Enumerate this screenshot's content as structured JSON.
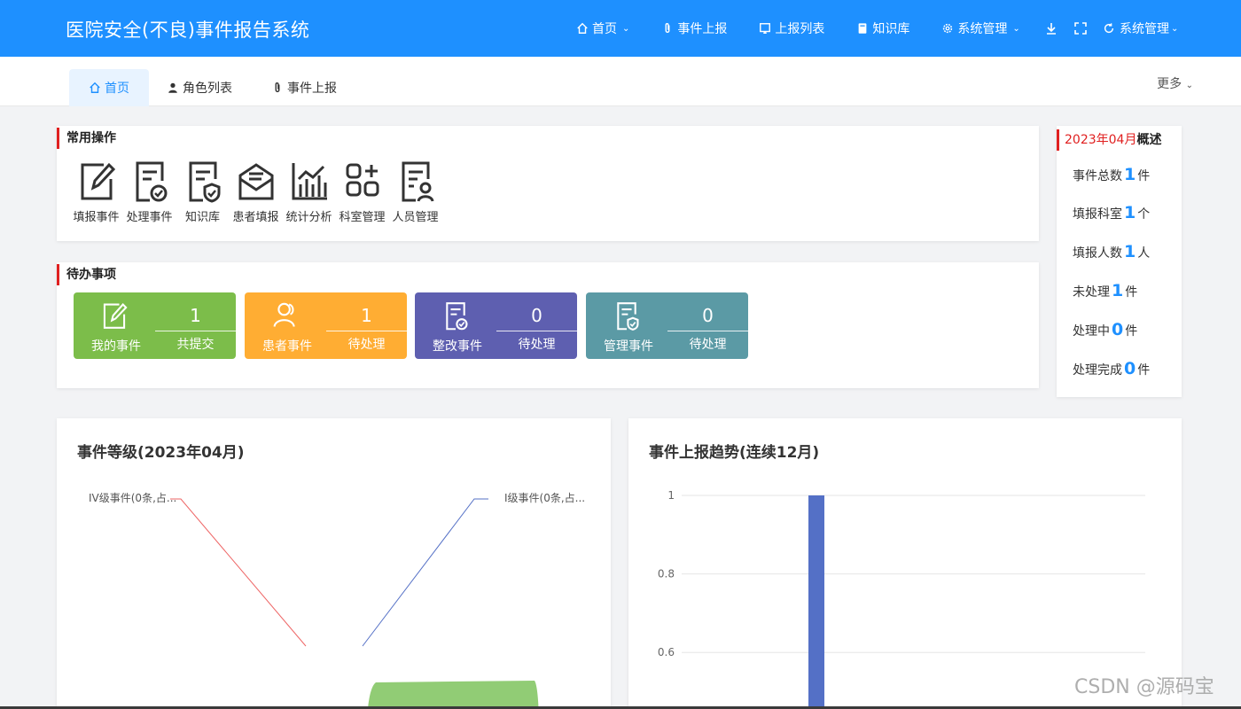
{
  "header": {
    "title": "医院安全(不良)事件报告系统",
    "nav": [
      {
        "label": "首页",
        "icon": "home-icon",
        "has_dropdown": true
      },
      {
        "label": "事件上报",
        "icon": "paperclip-icon",
        "has_dropdown": false
      },
      {
        "label": "上报列表",
        "icon": "list-icon",
        "has_dropdown": false
      },
      {
        "label": "知识库",
        "icon": "book-icon",
        "has_dropdown": false
      },
      {
        "label": "系统管理",
        "icon": "gear-icon",
        "has_dropdown": true
      }
    ],
    "user_menu_label": "系统管理"
  },
  "tabs": {
    "items": [
      {
        "label": "首页",
        "icon": "home-icon",
        "active": true
      },
      {
        "label": "角色列表",
        "icon": "user-icon",
        "active": false
      },
      {
        "label": "事件上报",
        "icon": "paperclip-icon",
        "active": false
      }
    ],
    "more": "更多"
  },
  "common_ops": {
    "title": "常用操作",
    "items": [
      {
        "label": "填报事件",
        "icon": "edit-icon"
      },
      {
        "label": "处理事件",
        "icon": "document-check-icon"
      },
      {
        "label": "知识库",
        "icon": "document-shield-icon"
      },
      {
        "label": "患者填报",
        "icon": "envelope-icon"
      },
      {
        "label": "统计分析",
        "icon": "bar-chart-icon"
      },
      {
        "label": "科室管理",
        "icon": "grid-plus-icon"
      },
      {
        "label": "人员管理",
        "icon": "document-user-icon"
      }
    ]
  },
  "todo": {
    "title": "待办事项",
    "items": [
      {
        "label": "我的事件",
        "count": "1",
        "sub": "共提交",
        "color": "#7cbd4a",
        "icon": "edit-icon"
      },
      {
        "label": "患者事件",
        "count": "1",
        "sub": "待处理",
        "color": "#ffad33",
        "icon": "users-icon"
      },
      {
        "label": "整改事件",
        "count": "0",
        "sub": "待处理",
        "color": "#5e5fb0",
        "icon": "document-check-icon"
      },
      {
        "label": "管理事件",
        "count": "0",
        "sub": "待处理",
        "color": "#5b9aa5",
        "icon": "document-shield-icon"
      }
    ]
  },
  "summary": {
    "month": "2023年04月",
    "title": "概述",
    "rows": [
      {
        "label": "事件总数",
        "value": "1",
        "unit": "件"
      },
      {
        "label": "填报科室",
        "value": "1",
        "unit": "个"
      },
      {
        "label": "填报人数",
        "value": "1",
        "unit": "人"
      },
      {
        "label": "未处理",
        "value": "1",
        "unit": "件"
      },
      {
        "label": "处理中",
        "value": "0",
        "unit": "件"
      },
      {
        "label": "处理完成",
        "value": "0",
        "unit": "件"
      }
    ]
  },
  "charts": {
    "level_title": "事件等级(2023年04月)",
    "trend_title": "事件上报趋势(连续12月)"
  },
  "chart_data": [
    {
      "type": "pie",
      "title": "事件等级(2023年04月)",
      "labels": [
        "IV级事件(0条,占...",
        "I级事件(0条,占..."
      ],
      "label_colors": [
        "#ee6666",
        "#5470c6"
      ],
      "slice_visible_color": "#91cc75"
    },
    {
      "type": "bar",
      "title": "事件上报趋势(连续12月)",
      "yticks": [
        "1",
        "0.8",
        "0.6"
      ],
      "ylim": [
        0,
        1
      ],
      "values": [
        0,
        0,
        0,
        0,
        0,
        0,
        0,
        0,
        0,
        0,
        0,
        1
      ],
      "bar_color": "#5470c6",
      "grid": true
    }
  ],
  "watermark": "CSDN @源码宝"
}
